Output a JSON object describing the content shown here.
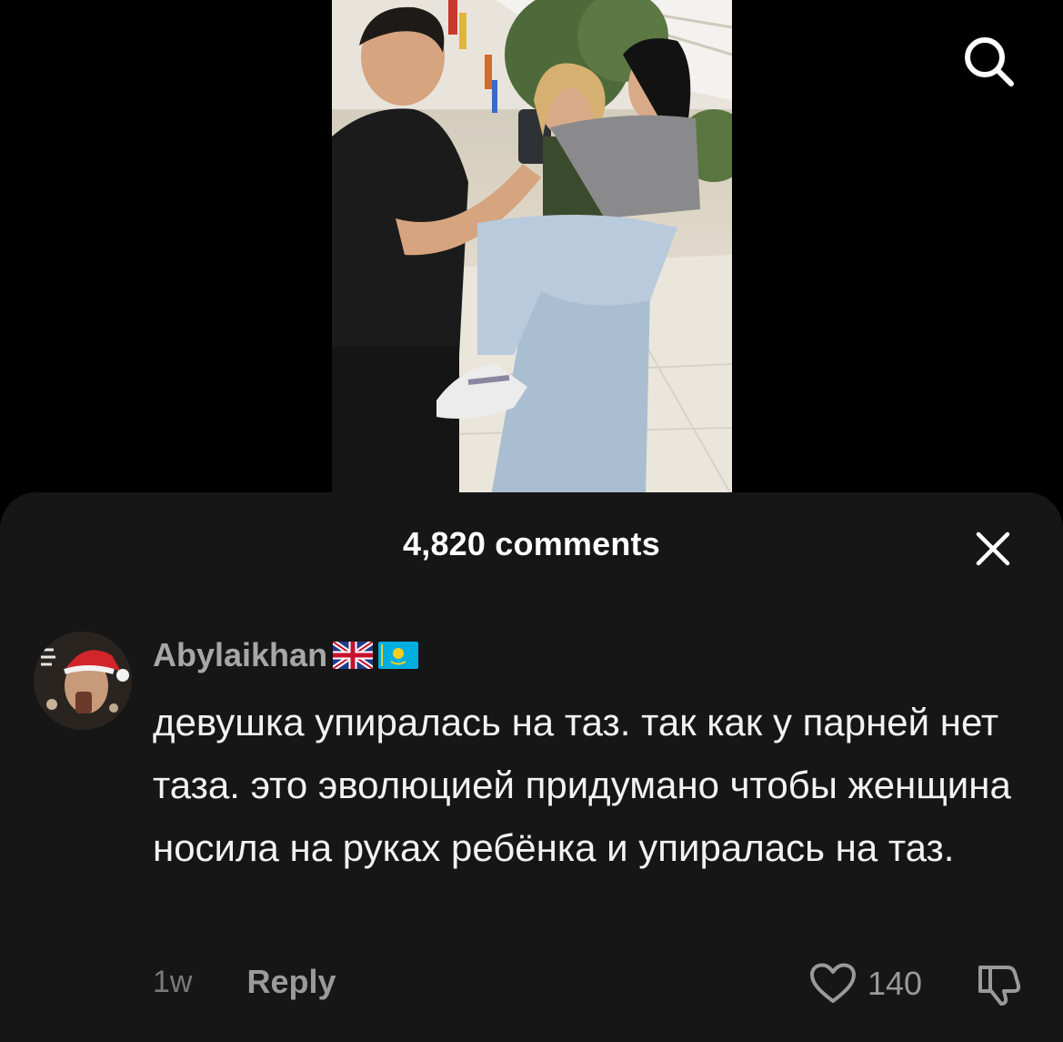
{
  "video": {
    "description_icon": "video-frame"
  },
  "header": {
    "search_icon": "search-icon"
  },
  "comments": {
    "title": "4,820 comments",
    "close_icon": "close-icon",
    "items": [
      {
        "username": "Abylaikhan",
        "flags": [
          "gb-flag-icon",
          "kz-flag-icon"
        ],
        "text": "девушка упиралась на таз. так как у парней нет таза. это эволюцией придумано чтобы женщина носила на руках ребёнка и упиралась на таз.",
        "time": "1w",
        "reply_label": "Reply",
        "likes": "140"
      }
    ]
  },
  "colors": {
    "sheet_bg": "#161616",
    "text_primary": "#f2f2f2",
    "text_secondary": "#a7a7a7"
  }
}
